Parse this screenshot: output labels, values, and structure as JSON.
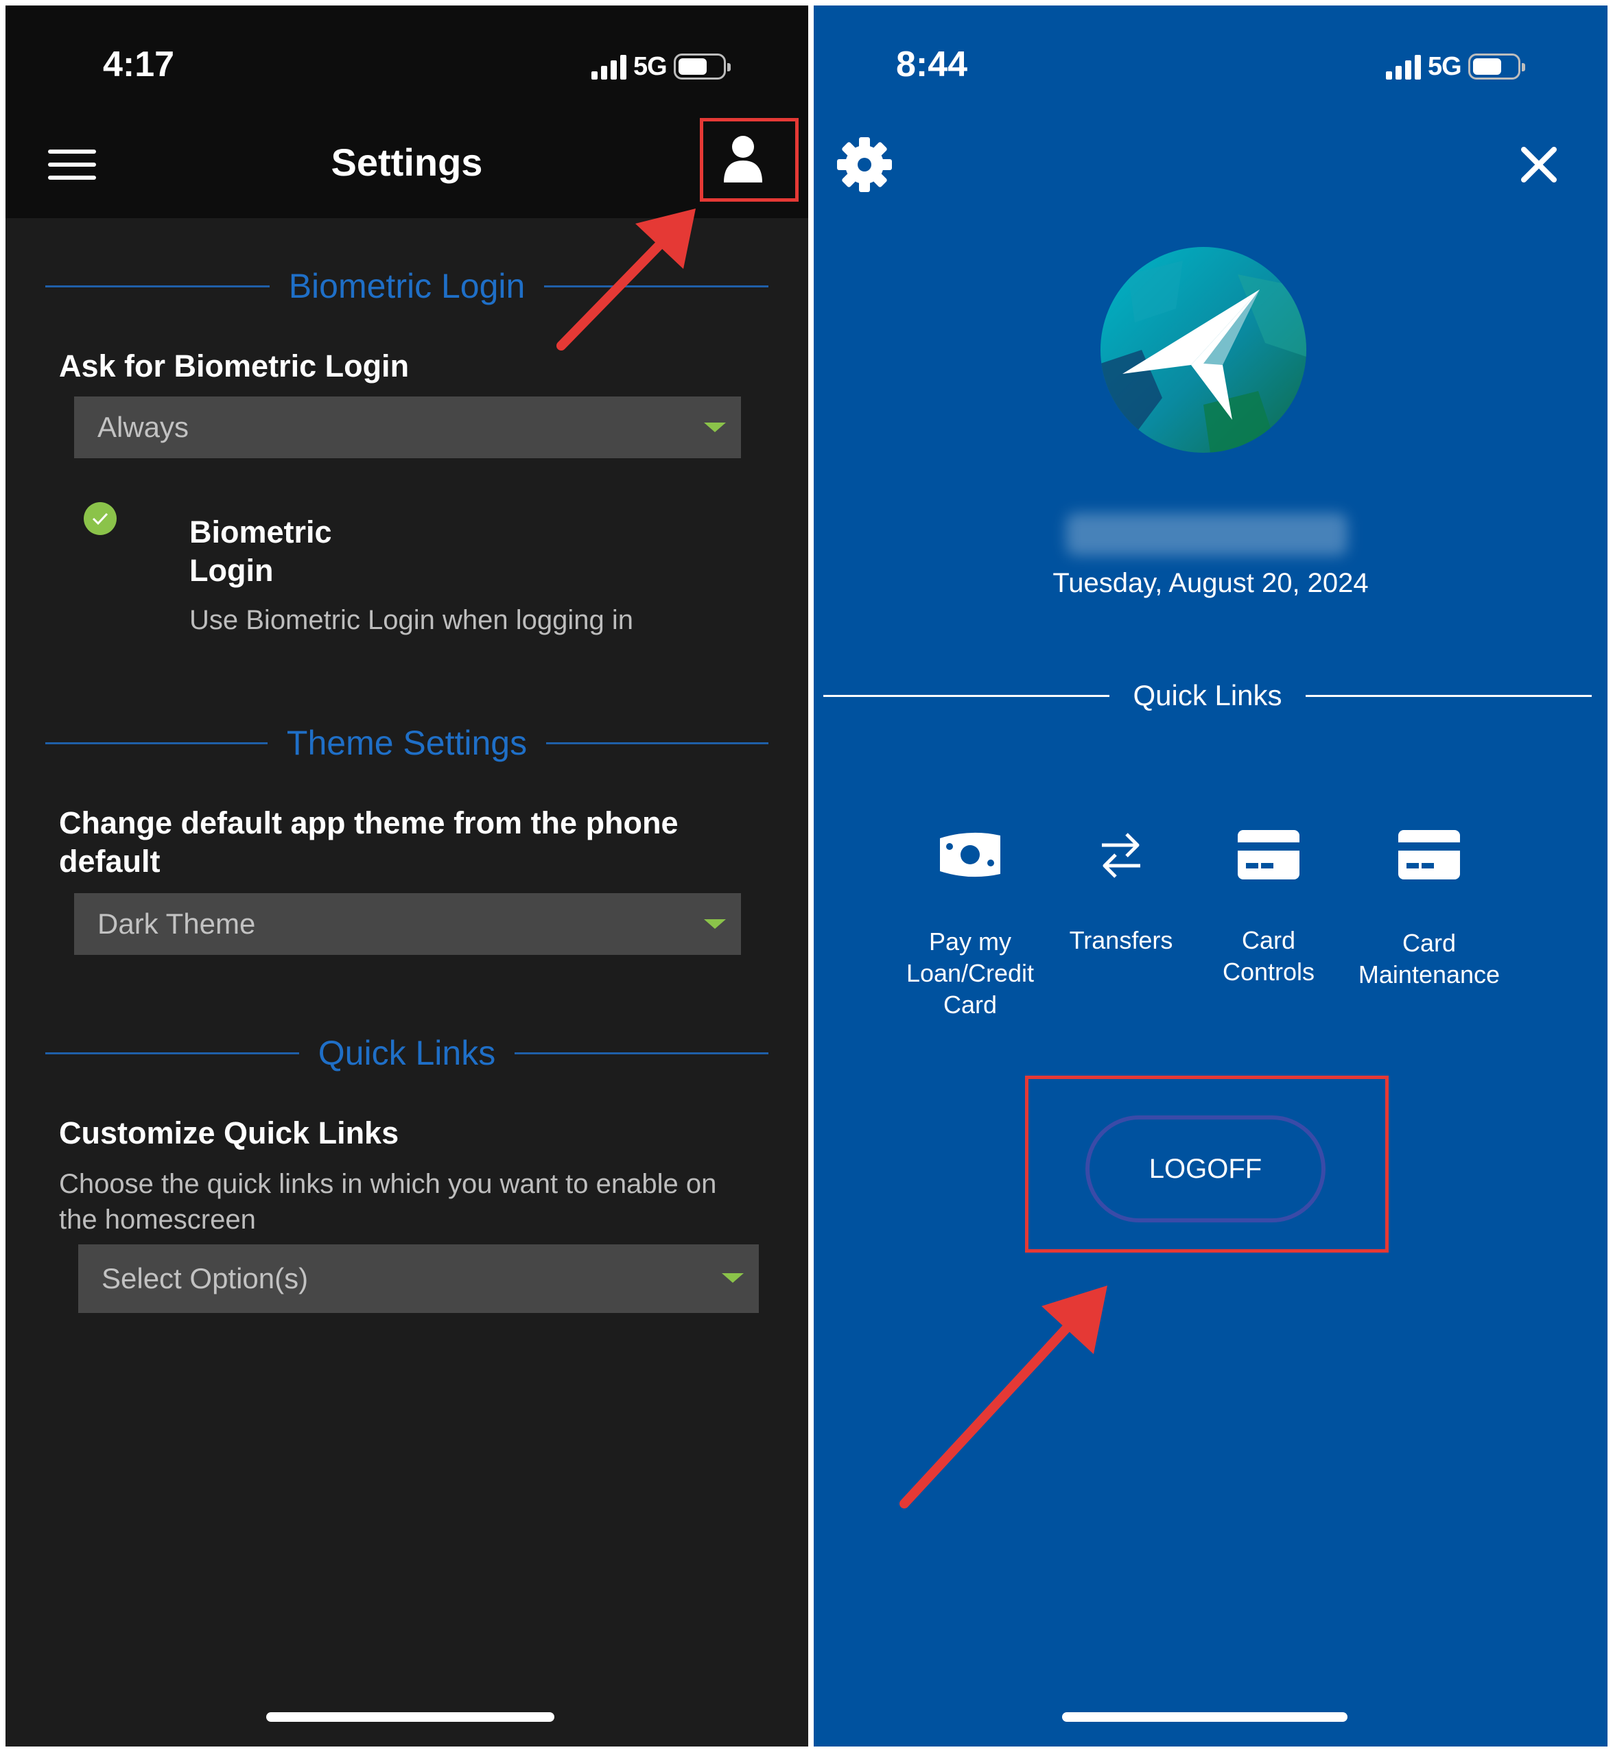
{
  "settings_screen": {
    "status_bar": {
      "time": "4:17",
      "network": "5G"
    },
    "header": {
      "title": "Settings",
      "menu_icon": "hamburger-icon",
      "profile_icon": "user-icon"
    },
    "sections": {
      "biometric": {
        "heading": "Biometric Login",
        "question": "Ask for Biometric Login",
        "dropdown_value": "Always",
        "option_title_line1": "Biometric",
        "option_title_line2": "Login",
        "option_description": "Use Biometric Login when logging in"
      },
      "theme": {
        "heading": "Theme Settings",
        "question_line1": "Change default app theme from the phone",
        "question_line2": "default",
        "dropdown_value": "Dark Theme"
      },
      "quick_links": {
        "heading": "Quick Links",
        "question": "Customize Quick Links",
        "description_line1": "Choose the quick links in which you want to enable on",
        "description_line2": "the homescreen",
        "dropdown_value": "Select Option(s)"
      }
    }
  },
  "menu_screen": {
    "status_bar": {
      "time": "8:44",
      "network": "5G"
    },
    "date": "Tuesday, August 20, 2024",
    "quick_links_heading": "Quick Links",
    "quick_links": [
      {
        "icon": "money-icon",
        "line1": "Pay my",
        "line2": "Loan/Credit",
        "line3": "Card"
      },
      {
        "icon": "transfer-arrows-icon",
        "line1": "Transfers"
      },
      {
        "icon": "credit-card-icon",
        "line1": "Card",
        "line2": "Controls"
      },
      {
        "icon": "credit-card-icon",
        "line1": "Card",
        "line2": "Maintenance"
      }
    ],
    "logoff_label": "LOGOFF"
  },
  "colors": {
    "left_background": "#1c1c1c",
    "left_header": "#0d0d0d",
    "section_heading": "#1f6fc7",
    "dropdown_caret": "#8bc34a",
    "right_background": "#00529f",
    "annotation": "#e53935"
  }
}
